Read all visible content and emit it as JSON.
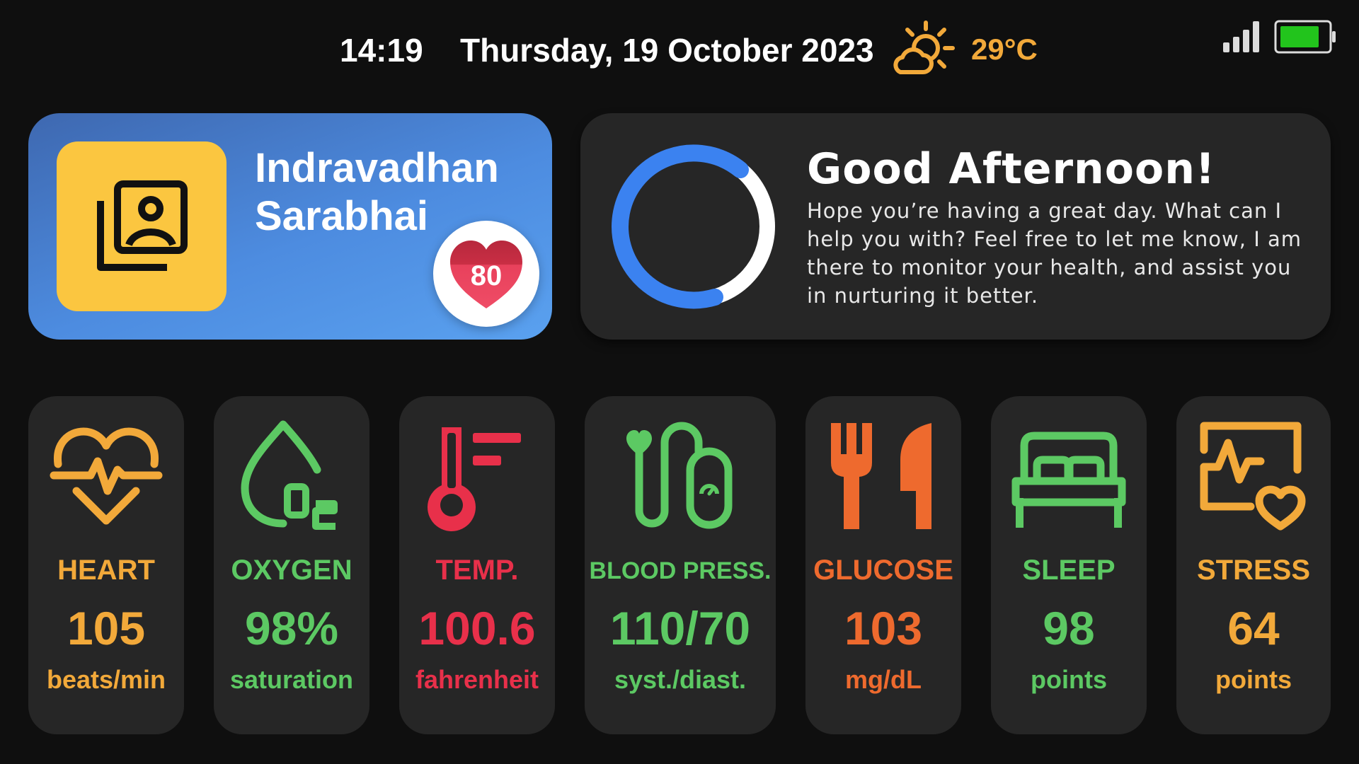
{
  "status_bar": {
    "time": "14:19",
    "date": "Thursday, 19 October 2023",
    "weather_icon": "sun-cloud-icon",
    "temperature": "29°C",
    "signal_icon": "cellular-signal-icon",
    "battery_icon": "battery-icon"
  },
  "profile": {
    "name_line1": "Indravadhan",
    "name_line2": "Sarabhai",
    "avatar_icon": "portrait-photo-icon",
    "heart_badge_value": "80"
  },
  "greeting": {
    "title": "Good Afternoon!",
    "message": "Hope you’re having a great day. What can I help you with? Feel free to let me know, I am there to monitor your health, and assist you in nurturing it better."
  },
  "metrics": [
    {
      "label": "HEART",
      "value": "105",
      "unit": "beats/min",
      "icon": "heart-pulse-icon",
      "color": "#f2a93a"
    },
    {
      "label": "OXYGEN",
      "value": "98%",
      "unit": "saturation",
      "icon": "oxygen-drop-icon",
      "color": "#5cc963"
    },
    {
      "label": "TEMP.",
      "value": "100.6",
      "unit": "fahrenheit",
      "icon": "thermometer-icon",
      "color": "#e8304a"
    },
    {
      "label": "BLOOD PRESS.",
      "value": "110/70",
      "unit": "syst./diast.",
      "icon": "blood-pressure-icon",
      "color": "#5cc963"
    },
    {
      "label": "GLUCOSE",
      "value": "103",
      "unit": "mg/dL",
      "icon": "fork-knife-icon",
      "color": "#ee6a2e"
    },
    {
      "label": "SLEEP",
      "value": "98",
      "unit": "points",
      "icon": "bed-icon",
      "color": "#5cc963"
    },
    {
      "label": "STRESS",
      "value": "64",
      "unit": "points",
      "icon": "stress-monitor-icon",
      "color": "#f2a93a"
    }
  ]
}
